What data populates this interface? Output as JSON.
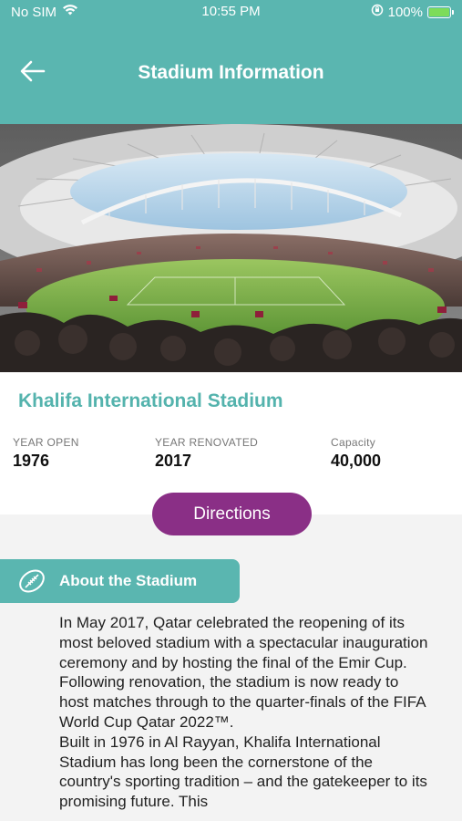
{
  "status_bar": {
    "carrier": "No SIM",
    "time": "10:55 PM",
    "battery": "100%",
    "icons": [
      "wifi-icon",
      "orientation-lock-icon",
      "battery-charging-icon"
    ]
  },
  "header": {
    "title": "Stadium Information",
    "back_icon": "back-arrow-icon"
  },
  "stadium": {
    "name": "Khalifa International Stadium",
    "stats": [
      {
        "label": "YEAR OPEN",
        "value": "1976"
      },
      {
        "label": "YEAR RENOVATED",
        "value": "2017"
      },
      {
        "label": "Capacity",
        "value": "40,000"
      }
    ]
  },
  "actions": {
    "directions_label": "Directions"
  },
  "about": {
    "title": "About the Stadium",
    "icon": "rugby-ball-icon",
    "paragraphs": [
      "In May 2017, Qatar celebrated the reopening of its most beloved stadium with a spectacular inauguration ceremony and by hosting the final of the Emir Cup. Following renovation, the stadium is now ready to host matches through to the quarter-finals of the FIFA World Cup Qatar 2022™.",
      "Built in 1976 in Al Rayyan, Khalifa International Stadium has long been the cornerstone of the country's sporting tradition – and the gatekeeper to its promising future. This"
    ]
  },
  "colors": {
    "primary": "#5ab6b0",
    "accent": "#8a2f86",
    "title_text": "#54b3ad"
  }
}
